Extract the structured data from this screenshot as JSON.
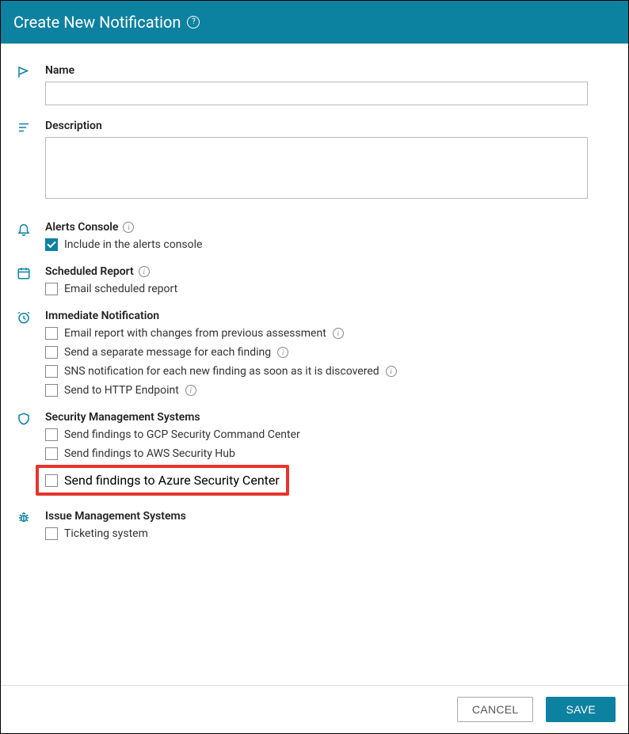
{
  "header": {
    "title": "Create New Notification"
  },
  "sections": {
    "name": {
      "label": "Name",
      "value": ""
    },
    "description": {
      "label": "Description",
      "value": ""
    },
    "alerts": {
      "label": "Alerts Console",
      "include": {
        "label": "Include in the alerts console",
        "checked": true
      }
    },
    "scheduled": {
      "label": "Scheduled Report",
      "email": {
        "label": "Email scheduled report",
        "checked": false
      }
    },
    "immediate": {
      "label": "Immediate Notification",
      "options": [
        {
          "label": "Email report with changes from previous assessment",
          "checked": false,
          "info": true
        },
        {
          "label": "Send a separate message for each finding",
          "checked": false,
          "info": true
        },
        {
          "label": "SNS notification for each new finding as soon as it is discovered",
          "checked": false,
          "info": true
        },
        {
          "label": "Send to HTTP Endpoint",
          "checked": false,
          "info": true
        }
      ]
    },
    "security": {
      "label": "Security Management Systems",
      "options": [
        {
          "label": "Send findings to GCP Security Command Center",
          "checked": false,
          "highlight": false
        },
        {
          "label": "Send findings to AWS Security Hub",
          "checked": false,
          "highlight": false
        },
        {
          "label": "Send findings to Azure Security Center",
          "checked": false,
          "highlight": true
        }
      ]
    },
    "issue": {
      "label": "Issue Management Systems",
      "ticketing": {
        "label": "Ticketing system",
        "checked": false
      }
    }
  },
  "footer": {
    "cancel": "CANCEL",
    "save": "SAVE"
  }
}
